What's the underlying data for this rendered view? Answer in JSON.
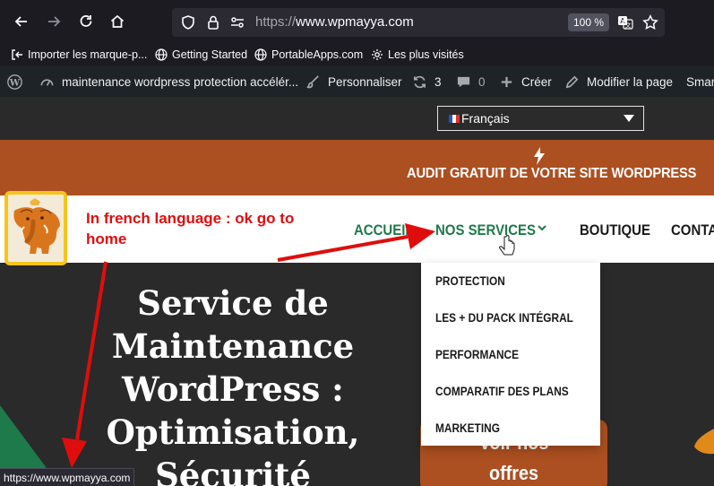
{
  "browser": {
    "url_scheme": "https://",
    "url_host": "www.wpmayya.com",
    "zoom": "100 %",
    "nav_icons": [
      "back-icon",
      "forward-icon",
      "reload-icon",
      "home-icon"
    ],
    "bookmarks": [
      {
        "label": "Importer les marque-p...",
        "icon": "import-icon"
      },
      {
        "label": "Getting Started",
        "icon": "globe-icon"
      },
      {
        "label": "PortableApps.com",
        "icon": "globe-icon"
      },
      {
        "label": "Les plus visités",
        "icon": "gear-icon"
      }
    ]
  },
  "adminbar": {
    "site_title": "maintenance wordpress protection accélér...",
    "customize": "Personnaliser",
    "updates_count": "3",
    "comments_count": "0",
    "new": "Créer",
    "edit": "Modifier la page",
    "truncated": "Smar"
  },
  "page": {
    "language": "Français",
    "promo": "AUDIT GRATUIT DE VOTRE SITE WORDPRESS",
    "annotation": "In french language : ok go to home",
    "menu": [
      "ACCUEIL",
      "NOS SERVICES",
      "BOUTIQUE",
      "CONTAC"
    ],
    "services_menu": [
      "PROTECTION",
      "LES + DU PACK INTÉGRAL",
      "PERFORMANCE",
      "COMPARATIF DES PLANS",
      "MARKETING"
    ],
    "hero_lines": [
      "Service de",
      "Maintenance",
      "WordPress :",
      "Optimisation,",
      "Sécurité"
    ],
    "cta_lines": [
      "Voir nos",
      "offres"
    ],
    "status_url": "https://www.wpmayya.com"
  },
  "colors": {
    "promo_bg": "#ac4f21",
    "menu_active": "#1e7a4b",
    "annotation": "#e00d0d",
    "logo_border": "#f5c51c"
  }
}
